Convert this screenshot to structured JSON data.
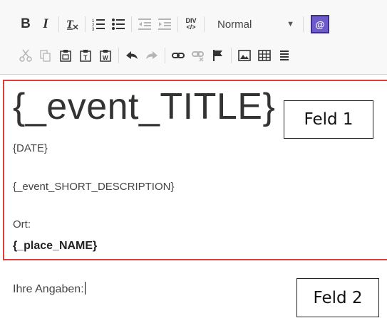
{
  "toolbar": {
    "bold_label": "B",
    "italic_label": "I",
    "format_label": "Normal",
    "purple_button_label": "@",
    "div_label_top": "DIV",
    "div_label_bottom": "</>"
  },
  "editor": {
    "title": "{_event_TITLE}",
    "date": "{DATE}",
    "short_description": "{_event_SHORT_DESCRIPTION}",
    "place_label": "Ort:",
    "place_name": "{_place_NAME}",
    "input_prompt": "Ihre Angaben:"
  },
  "callouts": {
    "field1": "Feld 1",
    "field2": "Feld 2"
  },
  "colors": {
    "highlight_border": "#e23b3b",
    "accent_purple": "#6f5acb"
  }
}
